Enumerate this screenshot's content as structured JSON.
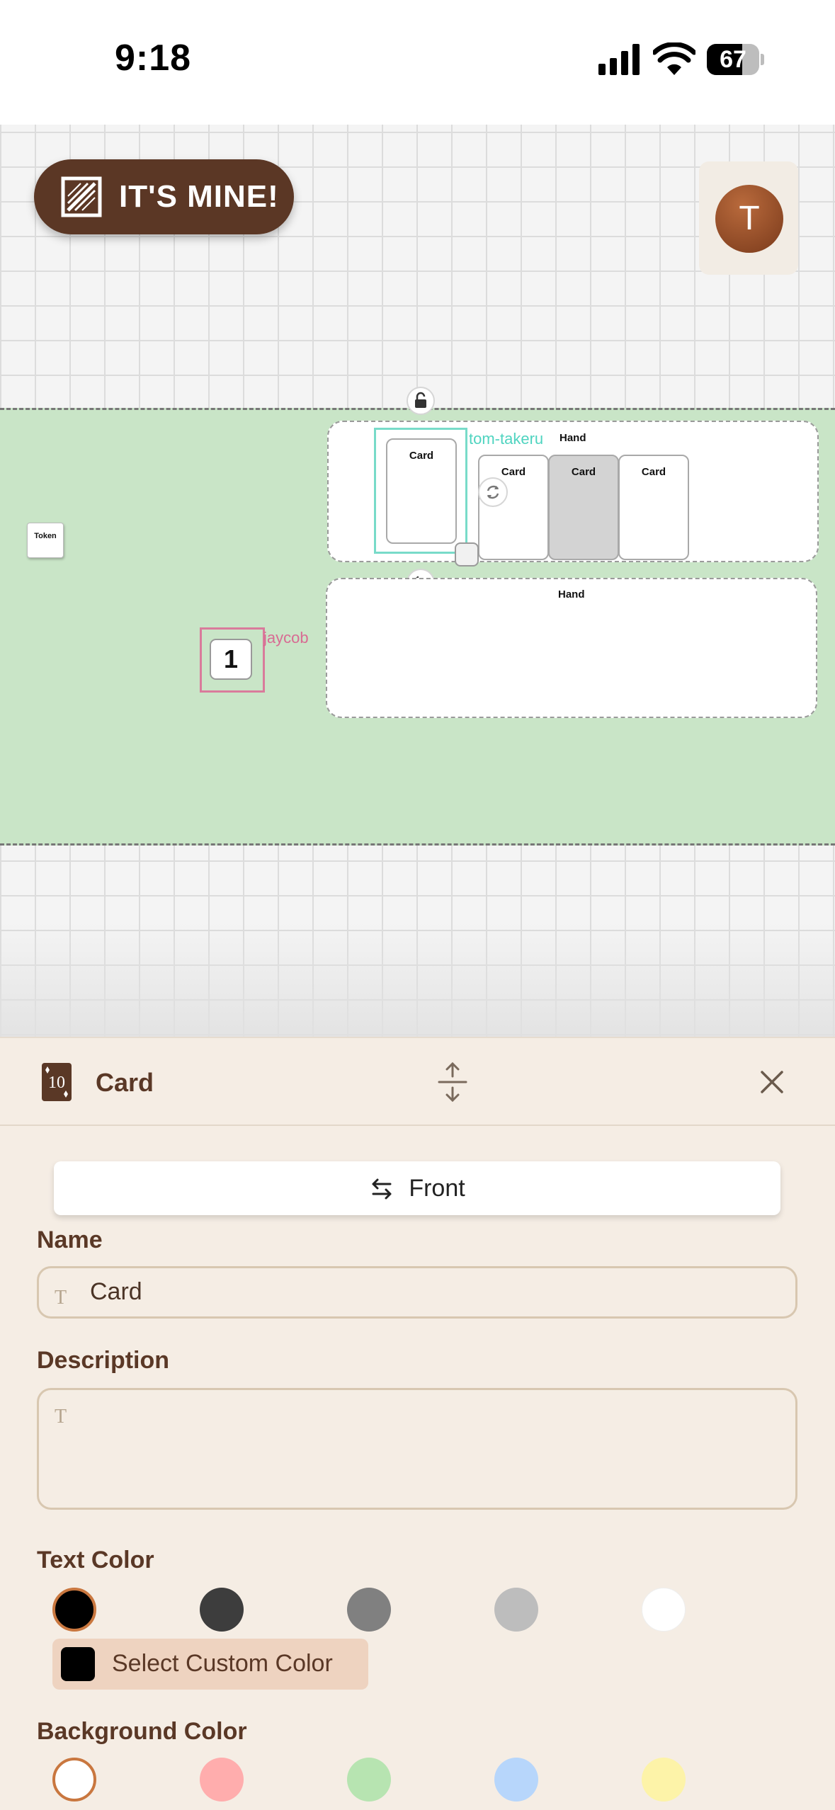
{
  "status_bar": {
    "time": "9:18",
    "battery_level": "67",
    "battery_fraction": 0.67
  },
  "canvas": {
    "brand": {
      "label": "IT'S MINE!",
      "color": "#5b3725"
    },
    "avatar": {
      "initial": "T",
      "color": "#8a4321"
    },
    "zone_color": "#c9e5c7",
    "hands": [
      {
        "label": "Hand",
        "cards": [
          "Card",
          "Card",
          "Card"
        ],
        "owner": "tom-takeru",
        "owner_color": "#4fd4c0"
      },
      {
        "label": "Hand",
        "cards": []
      }
    ],
    "selected_card": {
      "label": "Card"
    },
    "token": {
      "label": "Token"
    },
    "counter": {
      "value": "1",
      "owner": "jaycob",
      "owner_color": "#d86b93"
    }
  },
  "panel": {
    "title": "Card",
    "card_icon_value": "10",
    "flip_label": "Front",
    "name": {
      "label": "Name",
      "value": "Card",
      "type_icon": "T"
    },
    "description": {
      "label": "Description",
      "value": "",
      "type_icon": "T"
    },
    "text_color": {
      "label": "Text Color",
      "swatches": [
        "#000000",
        "#3d3d3d",
        "#808080",
        "#bdbdbd",
        "#ffffff"
      ],
      "selected_index": 0,
      "custom_label": "Select Custom Color"
    },
    "background_color": {
      "label": "Background Color",
      "swatches": [
        "#ffffff",
        "#ffadad",
        "#b7e4b1",
        "#b7d6fb",
        "#fdf3a8"
      ],
      "selected_index": 0
    },
    "accent_color": "#c9773f"
  }
}
